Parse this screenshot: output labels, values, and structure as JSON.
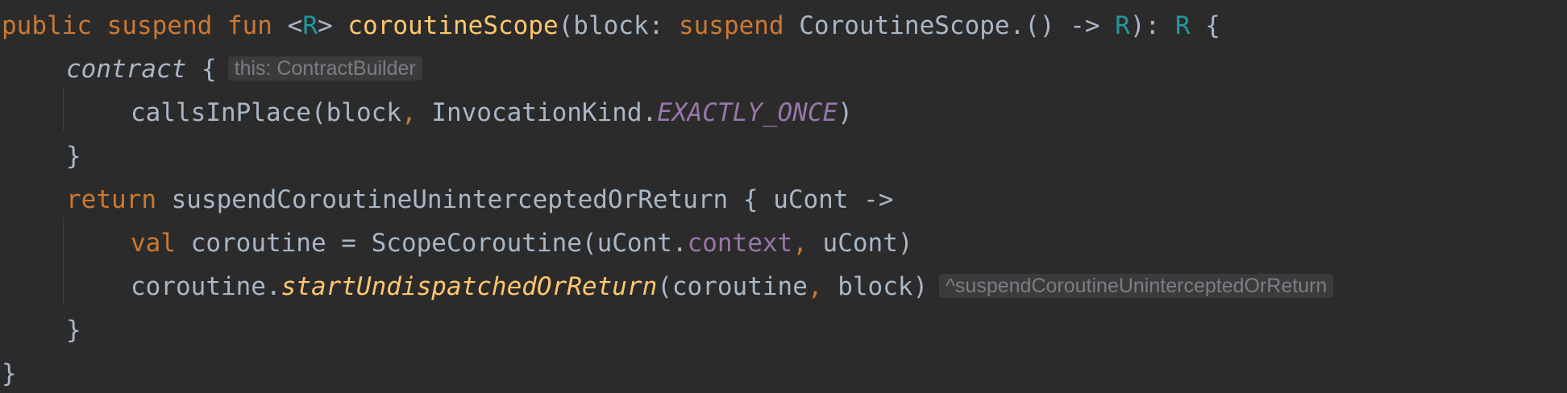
{
  "colors": {
    "background": "#2b2b2b",
    "default_text": "#a9b7c6",
    "keyword": "#cc7832",
    "function": "#ffc66d",
    "type_parameter": "#20999d",
    "property": "#9876aa",
    "inlay_hint_text": "#7a7e85",
    "inlay_hint_bg": "#3b3b3b"
  },
  "code": {
    "l1": {
      "kw_public": "public",
      "kw_suspend": "suspend",
      "kw_fun": "fun",
      "lt": "<",
      "type_r": "R",
      "gt": ">",
      "fn_name": "coroutineScope",
      "open_paren": "(block: ",
      "kw_suspend2": "suspend",
      "receiver": " CoroutineScope.() -> ",
      "ret_r": "R",
      "mid": "): ",
      "ret_r2": "R",
      "brace": " {"
    },
    "l2": {
      "contract": "contract",
      "brace": " {",
      "hint": "this: ContractBuilder"
    },
    "l3": {
      "calls": "callsInPlace(block",
      "comma": ",",
      "kind": " InvocationKind.",
      "const": "EXACTLY_ONCE",
      "close": ")"
    },
    "l4": {
      "brace": "}"
    },
    "l5": {
      "kw_return": "return",
      "call": " suspendCoroutineUninterceptedOrReturn { uCont ->"
    },
    "l6": {
      "kw_val": "val",
      "assign": " coroutine = ScopeCoroutine(uCont.",
      "prop": "context",
      "comma": ",",
      "rest": " uCont)"
    },
    "l7": {
      "obj": "coroutine.",
      "fn": "startUndispatchedOrReturn",
      "args_a": "(coroutine",
      "comma": ",",
      "args_b": " block)",
      "hint": "^suspendCoroutineUninterceptedOrReturn"
    },
    "l8": {
      "brace": "}"
    },
    "l9": {
      "brace": "}"
    }
  }
}
